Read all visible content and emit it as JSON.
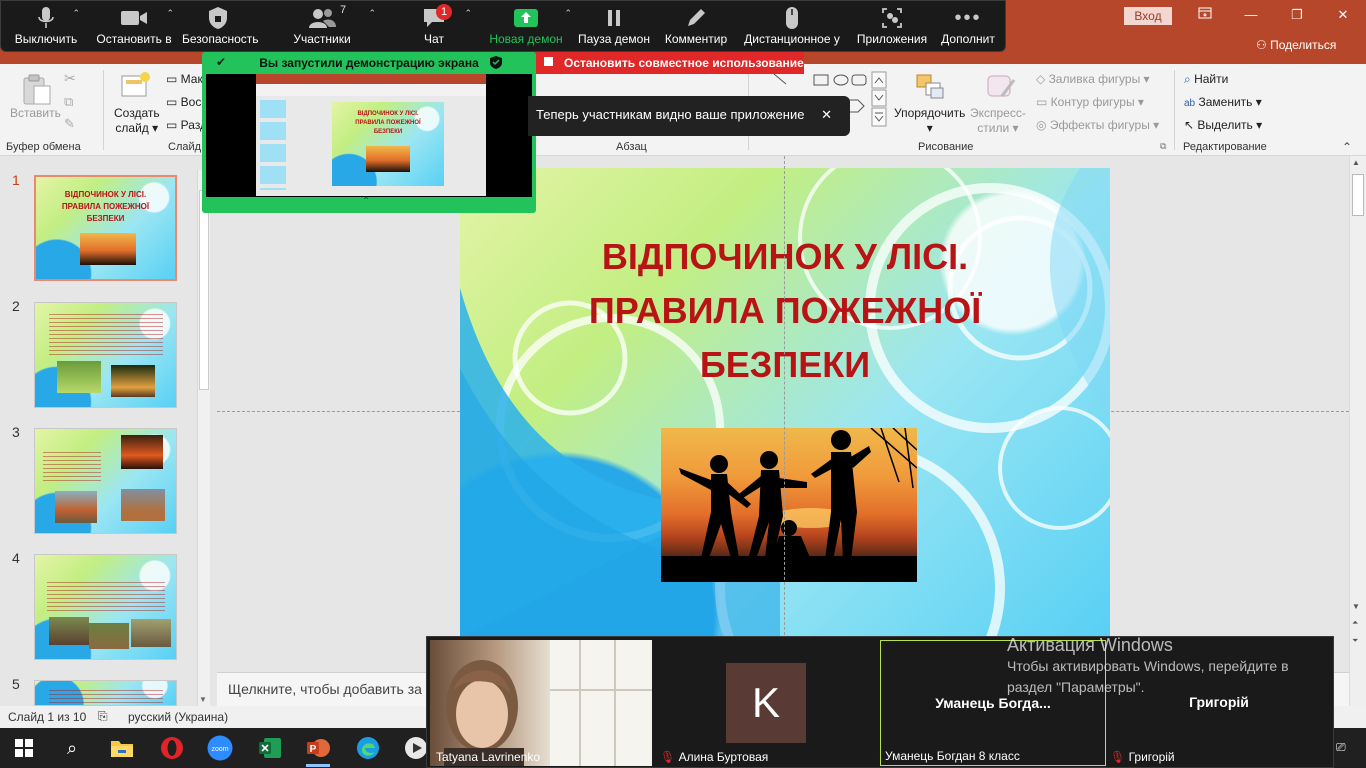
{
  "titlebar": {
    "login": "Вход",
    "share": "Поделиться"
  },
  "zoom_toolbar": {
    "tools": [
      {
        "label": "Выключить",
        "icon": "microphone-icon"
      },
      {
        "label": "Остановить в",
        "icon": "video-camera-icon"
      },
      {
        "label": "Безопасность",
        "icon": "shield-icon"
      },
      {
        "label": "Участники",
        "icon": "participants-icon",
        "count": "7"
      },
      {
        "label": "Чат",
        "icon": "chat-icon",
        "badge": "1"
      },
      {
        "label": "Новая демон",
        "icon": "share-screen-icon"
      },
      {
        "label": "Пауза демон",
        "icon": "pause-icon"
      },
      {
        "label": "Комментир",
        "icon": "annotate-pen-icon"
      },
      {
        "label": "Дистанционное у",
        "icon": "remote-control-mouse-icon"
      },
      {
        "label": "Приложения",
        "icon": "apps-icon"
      },
      {
        "label": "Дополнит",
        "icon": "more-dots-icon"
      }
    ],
    "accent": "#21c35a"
  },
  "share": {
    "banner": "Вы запустили демонстрацию экрана",
    "stop": "Остановить совместное использование",
    "toast": "Теперь участникам видно ваше приложение"
  },
  "ribbon": {
    "paste": "Вставить",
    "clipboard_group": "Буфер обмена",
    "new_slide_1": "Создать",
    "new_slide_2": "слайд",
    "layout": "Мак",
    "reset": "Вос",
    "section": "Разд",
    "slides_group": "Слайд",
    "paragraph_group": "Абзац",
    "arrange": "Упорядочить",
    "quick_styles_1": "Экспресс-",
    "quick_styles_2": "стили",
    "shape_fill": "Заливка фигуры",
    "shape_outline": "Контур фигуры",
    "shape_effects": "Эффекты фигуры",
    "drawing_group": "Рисование",
    "find": "Найти",
    "replace": "Заменить",
    "select": "Выделить",
    "editing_group": "Редактирование"
  },
  "thumbnails": {
    "numbers": [
      "1",
      "2",
      "3",
      "4",
      "5"
    ],
    "slide1_title": "ВІДПОЧИНОК У ЛІСІ. ПРАВИЛА ПОЖЕЖНОЇ БЕЗПЕКИ"
  },
  "slide": {
    "title_lines": [
      "ВІДПОЧИНОК У ЛІСІ.",
      "ПРАВИЛА ПОЖЕЖНОЇ",
      "БЕЗПЕКИ"
    ]
  },
  "notes": {
    "placeholder": "Щелкните, чтобы добавить за"
  },
  "status": {
    "slide_count": "Слайд 1 из 10",
    "language": "русский (Украина)"
  },
  "video": {
    "tile1_name": "Tatyana Lavrinenko",
    "tile2_initial": "K",
    "tile2_name": "Алина Буртовая",
    "tile3_display": "Уманець  Богда...",
    "tile3_name": "Уманець Богдан 8 класс",
    "tile4_display": "Григорій",
    "tile4_name": "Григорій"
  },
  "activation": {
    "title": "Активация Windows",
    "line1": "Чтобы активировать Windows, перейдите в",
    "line2": "раздел \"Параметры\"."
  }
}
